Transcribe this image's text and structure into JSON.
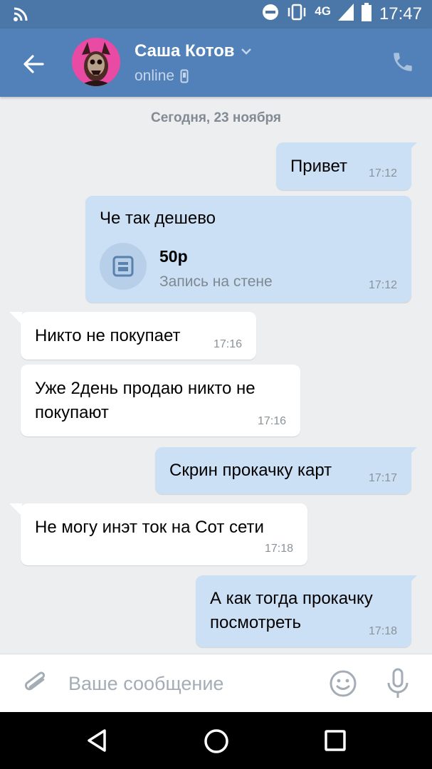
{
  "status_bar": {
    "network": "4G",
    "time": "17:47"
  },
  "header": {
    "contact_name": "Саша Котов",
    "status": "online"
  },
  "date_separator": "Сегодня, 23 ноября",
  "messages": [
    {
      "direction": "out",
      "text": "Привет",
      "time": "17:12"
    },
    {
      "direction": "out",
      "text": "Че так дешево",
      "time": "17:12",
      "attachment": {
        "title": "50р",
        "subtitle": "Запись на стене",
        "icon": "wall-post-icon"
      }
    },
    {
      "direction": "in",
      "text": "Никто не покупает",
      "time": "17:16"
    },
    {
      "direction": "in",
      "text_lines": [
        "Уже 2день продаю никто не",
        "покупают"
      ],
      "time": "17:16"
    },
    {
      "direction": "out",
      "text": "Скрин прокачку карт",
      "time": "17:17"
    },
    {
      "direction": "in",
      "text": "Не могу инэт ток на Сот сети",
      "time": "17:18"
    },
    {
      "direction": "out",
      "text_lines": [
        "А как тогда прокачку",
        "посмотреть"
      ],
      "time": "17:18"
    }
  ],
  "composer": {
    "placeholder": "Ваше сообщение"
  },
  "colors": {
    "header": "#5181b8",
    "status_bar": "#4a76a8",
    "outgoing_bubble": "#cce0f5",
    "incoming_bubble": "#ffffff",
    "background": "#edeef0"
  },
  "icons": [
    "wifi-icon",
    "dnd-icon",
    "vibrate-icon",
    "signal-icon",
    "battery-icon",
    "back-arrow-icon",
    "chevron-down-icon",
    "mobile-icon",
    "phone-icon",
    "paperclip-icon",
    "emoji-icon",
    "microphone-icon",
    "nav-back-icon",
    "nav-home-icon",
    "nav-recent-icon"
  ]
}
